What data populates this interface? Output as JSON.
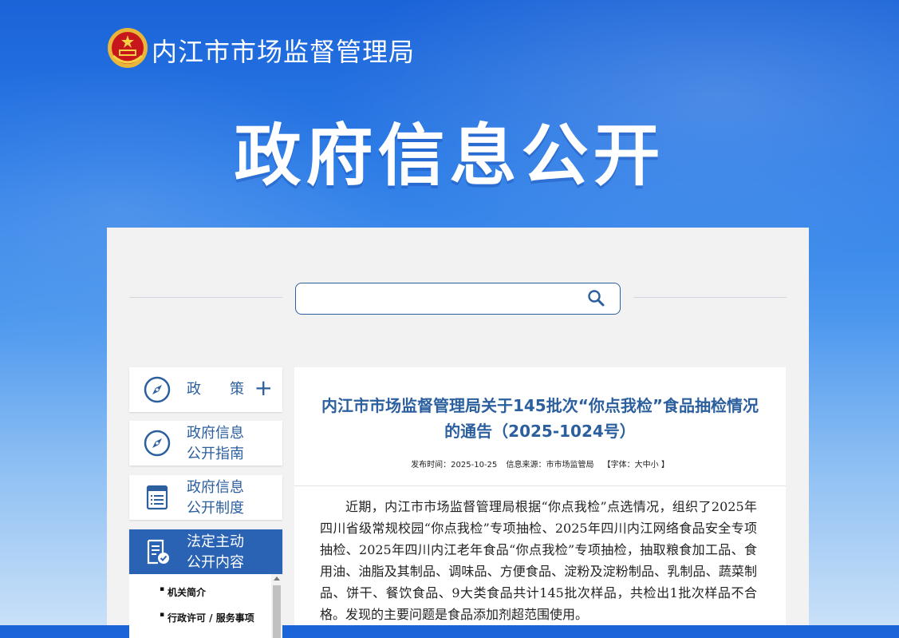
{
  "header": {
    "site_name": "内江市市场监督管理局",
    "banner_title": "政府信息公开"
  },
  "search": {
    "placeholder": "",
    "value": ""
  },
  "sidebar": {
    "items": [
      {
        "label": "政　　策",
        "icon": "compass-icon",
        "expand": "+"
      },
      {
        "label_line1": "政府信息",
        "label_line2": "公开指南",
        "icon": "compass-icon"
      },
      {
        "label_line1": "政府信息",
        "label_line2": "公开制度",
        "icon": "document-list-icon"
      },
      {
        "label_line1": "法定主动",
        "label_line2": "公开内容",
        "icon": "document-check-icon"
      }
    ],
    "submenu": [
      "机关简介",
      "行政许可 / 服务事项"
    ]
  },
  "article": {
    "title": "内江市市场监督管理局关于145批次“你点我检”食品抽检情况的通告（2025-1024号）",
    "publish_label": "发布时间：2025-10-25",
    "source_label": "信息来源：市市场监管局",
    "font_size_label": "【字体：大中小 】",
    "body": "近期，内江市市场监督管理局根据“你点我检”点选情况，组织了2025年四川省级常规校园“你点我检”专项抽检、2025年四川内江网络食品安全专项抽检、2025年四川内江老年食品“你点我检”专项抽检，抽取粮食加工品、食用油、油脂及其制品、调味品、方便食品、淀粉及淀粉制品、乳制品、蔬菜制品、饼干、餐饮食品、9大类食品共计145批次样品，共检出1批次样品不合格。发现的主要问题是食品添加剂超范围使用。"
  },
  "colors": {
    "accent": "#2c5f9e",
    "active_bg": "#2a63b4",
    "panel_bg": "#f2f2f2"
  }
}
